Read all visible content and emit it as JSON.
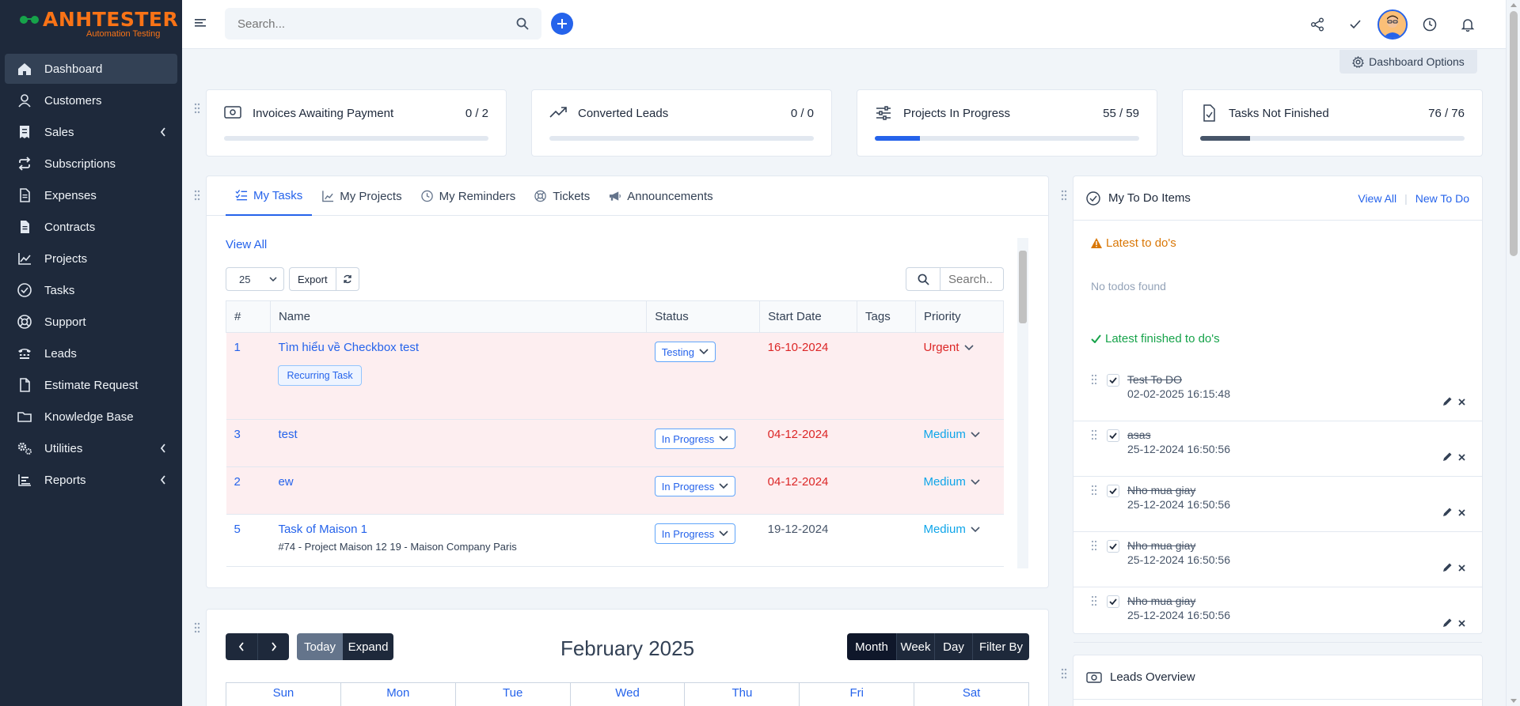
{
  "brand": {
    "name": "ANHTESTER",
    "tagline": "Automation Testing",
    "color": "#f97316"
  },
  "sidebar": {
    "items": [
      {
        "label": "Dashboard",
        "icon": "home-icon",
        "active": true
      },
      {
        "label": "Customers",
        "icon": "user-icon"
      },
      {
        "label": "Sales",
        "icon": "receipt-icon",
        "submenu": true
      },
      {
        "label": "Subscriptions",
        "icon": "repeat-icon"
      },
      {
        "label": "Expenses",
        "icon": "document-icon"
      },
      {
        "label": "Contracts",
        "icon": "contract-icon"
      },
      {
        "label": "Projects",
        "icon": "chart-icon"
      },
      {
        "label": "Tasks",
        "icon": "check-circle-icon"
      },
      {
        "label": "Support",
        "icon": "lifebuoy-icon"
      },
      {
        "label": "Leads",
        "icon": "tty-icon"
      },
      {
        "label": "Estimate Request",
        "icon": "file-icon"
      },
      {
        "label": "Knowledge Base",
        "icon": "folder-icon"
      },
      {
        "label": "Utilities",
        "icon": "cogs-icon",
        "submenu": true
      },
      {
        "label": "Reports",
        "icon": "bar-chart-icon",
        "submenu": true
      }
    ]
  },
  "header": {
    "search_placeholder": "Search...",
    "icons": [
      "share-icon",
      "check-icon",
      "avatar",
      "clock-icon",
      "bell-icon"
    ]
  },
  "dashboard_options": "Dashboard Options",
  "stats": [
    {
      "title": "Invoices Awaiting Payment",
      "value": "0 / 2",
      "progress": 0,
      "icon": "money-icon"
    },
    {
      "title": "Converted Leads",
      "value": "0 / 0",
      "progress": 0,
      "icon": "trending-up-icon"
    },
    {
      "title": "Projects In Progress",
      "value": "55 / 59",
      "progress": 0.17,
      "icon": "sliders-icon"
    },
    {
      "title": "Tasks Not Finished",
      "value": "76 / 76",
      "progress": 0.19,
      "icon": "file-check-icon"
    }
  ],
  "tasks_panel": {
    "tabs": [
      {
        "label": "My Tasks",
        "icon": "list-check-icon",
        "active": true
      },
      {
        "label": "My Projects",
        "icon": "chart-line-icon"
      },
      {
        "label": "My Reminders",
        "icon": "clock-icon"
      },
      {
        "label": "Tickets",
        "icon": "lifebuoy-icon"
      },
      {
        "label": "Announcements",
        "icon": "megaphone-icon"
      }
    ],
    "view_all": "View All",
    "page_length": "25",
    "export_label": "Export",
    "search_placeholder": "Search..",
    "columns": [
      "#",
      "Name",
      "Status",
      "Start Date",
      "Tags",
      "Priority"
    ],
    "rows": [
      {
        "id": "1",
        "name": "Tìm hiểu về Checkbox test",
        "badge": "Recurring Task",
        "status": "Testing",
        "start": "16-10-2024",
        "tags": "",
        "priority": "Urgent",
        "overdue": true
      },
      {
        "id": "3",
        "name": "test",
        "status": "In Progress",
        "start": "04-12-2024",
        "tags": "",
        "priority": "Medium",
        "overdue": true
      },
      {
        "id": "2",
        "name": "ew",
        "status": "In Progress",
        "start": "04-12-2024",
        "tags": "",
        "priority": "Medium",
        "overdue": true
      },
      {
        "id": "5",
        "name": "Task of Maison 1",
        "sub": "#74 - Project Maison 12 19 - Maison Company Paris",
        "status": "In Progress",
        "start": "19-12-2024",
        "tags": "",
        "priority": "Medium",
        "overdue": false
      }
    ]
  },
  "todo_panel": {
    "title": "My To Do Items",
    "view_all": "View All",
    "new_todo": "New To Do",
    "latest_title": "Latest to do's",
    "empty": "No todos found",
    "finished_title": "Latest finished to do's",
    "finished": [
      {
        "name": "Test To DO",
        "date": "02-02-2025 16:15:48"
      },
      {
        "name": "asas",
        "date": "25-12-2024 16:50:56"
      },
      {
        "name": "Nho mua giay",
        "date": "25-12-2024 16:50:56"
      },
      {
        "name": "Nho mua giay",
        "date": "25-12-2024 16:50:56"
      },
      {
        "name": "Nho mua giay",
        "date": "25-12-2024 16:50:56"
      }
    ]
  },
  "calendar": {
    "title": "February 2025",
    "today": "Today",
    "expand": "Expand",
    "views": [
      "Month",
      "Week",
      "Day",
      "Filter By"
    ],
    "days": [
      "Sun",
      "Mon",
      "Tue",
      "Wed",
      "Thu",
      "Fri",
      "Sat"
    ]
  },
  "leads_panel": {
    "title": "Leads Overview"
  },
  "colors": {
    "primary": "#2563eb",
    "sidebar": "#1e293b",
    "danger": "#dc2626",
    "success": "#16a34a",
    "warning": "#d97706"
  }
}
